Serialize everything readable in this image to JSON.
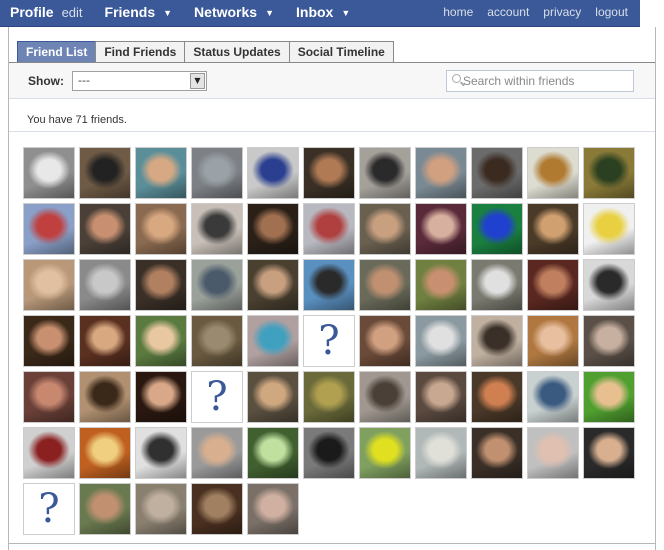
{
  "nav": {
    "profile": "Profile",
    "edit": "edit",
    "friends": "Friends",
    "networks": "Networks",
    "inbox": "Inbox",
    "caret": "▼",
    "home": "home",
    "account": "account",
    "privacy": "privacy",
    "logout": "logout"
  },
  "tabs": [
    "Friend List",
    "Find Friends",
    "Status Updates",
    "Social Timeline"
  ],
  "toolbar": {
    "show_label": "Show:",
    "select_value": "---",
    "search_placeholder": "Search within friends"
  },
  "friend_count_text": "You have 71 friends.",
  "colors": {
    "brand_blue": "#3b5998",
    "active_tab": "#6d84b4"
  },
  "photos": [
    {
      "kind": "photo",
      "bg": "#8f8f8f",
      "fg": "#e8e8e8"
    },
    {
      "kind": "photo",
      "bg": "#6e5a45",
      "fg": "#222222"
    },
    {
      "kind": "photo",
      "bg": "#5a8f9a",
      "fg": "#d6a884"
    },
    {
      "kind": "photo",
      "bg": "#7d8186",
      "fg": "#9aa2a8"
    },
    {
      "kind": "photo",
      "bg": "#c9c9c9",
      "fg": "#2a3f8f"
    },
    {
      "kind": "photo",
      "bg": "#3a3026",
      "fg": "#b07a55"
    },
    {
      "kind": "photo",
      "bg": "#a4a09a",
      "fg": "#2b2a2a"
    },
    {
      "kind": "photo",
      "bg": "#7a8a94",
      "fg": "#d0a080"
    },
    {
      "kind": "photo",
      "bg": "#6b6b6b",
      "fg": "#3a2a20"
    },
    {
      "kind": "photo",
      "bg": "#dcdcd0",
      "fg": "#b07a30"
    },
    {
      "kind": "photo",
      "bg": "#8a7a38",
      "fg": "#2a4020"
    },
    {
      "kind": "photo",
      "bg": "#8aa0c8",
      "fg": "#c04040"
    },
    {
      "kind": "photo",
      "bg": "#4a4038",
      "fg": "#c89070"
    },
    {
      "kind": "photo",
      "bg": "#8a6a50",
      "fg": "#d8a880"
    },
    {
      "kind": "photo",
      "bg": "#c8c0b8",
      "fg": "#3a3a3a"
    },
    {
      "kind": "photo",
      "bg": "#2a2018",
      "fg": "#a07050"
    },
    {
      "kind": "photo",
      "bg": "#b8b8c0",
      "fg": "#b04040"
    },
    {
      "kind": "photo",
      "bg": "#6a6050",
      "fg": "#c8a080"
    },
    {
      "kind": "photo",
      "bg": "#5a2a3a",
      "fg": "#d8b0a0"
    },
    {
      "kind": "photo",
      "bg": "#1a8040",
      "fg": "#2040d0"
    },
    {
      "kind": "photo",
      "bg": "#4a3a28",
      "fg": "#d0a070"
    },
    {
      "kind": "photo",
      "bg": "#f0f0f0",
      "fg": "#e8d040"
    },
    {
      "kind": "photo",
      "bg": "#b89878",
      "fg": "#e0c0a0"
    },
    {
      "kind": "photo",
      "bg": "#8a8a8a",
      "fg": "#c8c8c8"
    },
    {
      "kind": "photo",
      "bg": "#3a3028",
      "fg": "#b08060"
    },
    {
      "kind": "photo",
      "bg": "#9aa09a",
      "fg": "#4a5a6a"
    },
    {
      "kind": "photo",
      "bg": "#4a4030",
      "fg": "#c8a080"
    },
    {
      "kind": "photo",
      "bg": "#5a90c0",
      "fg": "#2a2a2a"
    },
    {
      "kind": "photo",
      "bg": "#6a6a5a",
      "fg": "#c09070"
    },
    {
      "kind": "photo",
      "bg": "#708040",
      "fg": "#c89070"
    },
    {
      "kind": "photo",
      "bg": "#7a7a70",
      "fg": "#e0e0e0"
    },
    {
      "kind": "photo",
      "bg": "#5a2820",
      "fg": "#c08060"
    },
    {
      "kind": "photo",
      "bg": "#d8d8d8",
      "fg": "#2a2a2a"
    },
    {
      "kind": "photo",
      "bg": "#3a2818",
      "fg": "#c89070"
    },
    {
      "kind": "photo",
      "bg": "#5a3020",
      "fg": "#d8a880"
    },
    {
      "kind": "photo",
      "bg": "#5a7a40",
      "fg": "#e8c8a0"
    },
    {
      "kind": "photo",
      "bg": "#6a5a40",
      "fg": "#9a8a70"
    },
    {
      "kind": "photo",
      "bg": "#b0a0a0",
      "fg": "#40a0c0"
    },
    {
      "kind": "unknown"
    },
    {
      "kind": "photo",
      "bg": "#6a4a38",
      "fg": "#d0a080"
    },
    {
      "kind": "photo",
      "bg": "#8a9aa0",
      "fg": "#e0e0e0"
    },
    {
      "kind": "photo",
      "bg": "#c0b0a0",
      "fg": "#3a3028"
    },
    {
      "kind": "photo",
      "bg": "#b07840",
      "fg": "#e8c0a0"
    },
    {
      "kind": "photo",
      "bg": "#5a5048",
      "fg": "#c8b0a0"
    },
    {
      "kind": "photo",
      "bg": "#6a4038",
      "fg": "#c88870"
    },
    {
      "kind": "photo",
      "bg": "#b09070",
      "fg": "#3a2818"
    },
    {
      "kind": "photo",
      "bg": "#2a1810",
      "fg": "#d8a888"
    },
    {
      "kind": "unknown"
    },
    {
      "kind": "photo",
      "bg": "#5a5040",
      "fg": "#d0a880"
    },
    {
      "kind": "photo",
      "bg": "#6a6a3a",
      "fg": "#b0a050"
    },
    {
      "kind": "photo",
      "bg": "#a09890",
      "fg": "#4a4038"
    },
    {
      "kind": "photo",
      "bg": "#5a4a40",
      "fg": "#c8a890"
    },
    {
      "kind": "photo",
      "bg": "#4a3828",
      "fg": "#d08050"
    },
    {
      "kind": "photo",
      "bg": "#c8d0d0",
      "fg": "#3a5a80"
    },
    {
      "kind": "photo",
      "bg": "#50a030",
      "fg": "#e8c090"
    },
    {
      "kind": "photo",
      "bg": "#d0d0d0",
      "fg": "#8a2020"
    },
    {
      "kind": "photo",
      "bg": "#c06020",
      "fg": "#f0d080"
    },
    {
      "kind": "photo",
      "bg": "#e0e0e0",
      "fg": "#303030"
    },
    {
      "kind": "photo",
      "bg": "#9a9a9a",
      "fg": "#d8b090"
    },
    {
      "kind": "photo",
      "bg": "#406030",
      "fg": "#c0e0a0"
    },
    {
      "kind": "photo",
      "bg": "#7a7a7a",
      "fg": "#1a1a1a"
    },
    {
      "kind": "photo",
      "bg": "#80a060",
      "fg": "#e0e020"
    },
    {
      "kind": "photo",
      "bg": "#b0b8b8",
      "fg": "#e0e0d8"
    },
    {
      "kind": "photo",
      "bg": "#3a3028",
      "fg": "#c09070"
    },
    {
      "kind": "photo",
      "bg": "#c0c0c0",
      "fg": "#e0c0b0"
    },
    {
      "kind": "photo",
      "bg": "#2a2a2a",
      "fg": "#d8b090"
    },
    {
      "kind": "unknown"
    },
    {
      "kind": "photo",
      "bg": "#6a7a50",
      "fg": "#c09070"
    },
    {
      "kind": "photo",
      "bg": "#8a8070",
      "fg": "#c0b0a0"
    },
    {
      "kind": "photo",
      "bg": "#4a3020",
      "fg": "#a08060"
    },
    {
      "kind": "photo",
      "bg": "#7a7068",
      "fg": "#d0b0a0"
    }
  ]
}
